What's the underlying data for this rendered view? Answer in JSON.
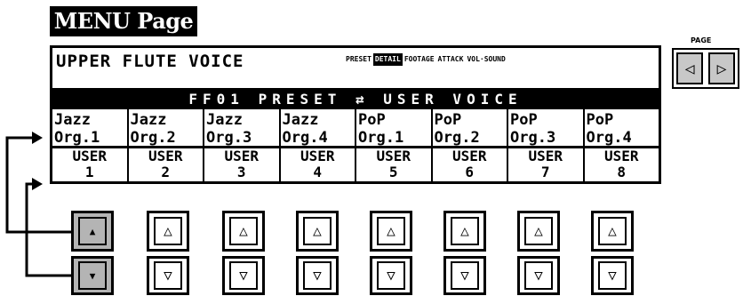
{
  "header": {
    "title": "MENU Page"
  },
  "lcd": {
    "title": "UPPER FLUTE VOICE",
    "tabs": [
      "PRESET",
      "DETAIL",
      "FOOTAGE",
      "ATTACK",
      "VOL·SOUND"
    ],
    "active_tab_index": 1,
    "banner": "FF01 PRESET ⇄ USER VOICE",
    "voices": [
      [
        "Jazz",
        "Org.1"
      ],
      [
        "Jazz",
        "Org.2"
      ],
      [
        "Jazz",
        "Org.3"
      ],
      [
        "Jazz",
        "Org.4"
      ],
      [
        "PoP",
        "Org.1"
      ],
      [
        "PoP",
        "Org.2"
      ],
      [
        "PoP",
        "Org.3"
      ],
      [
        "PoP",
        "Org.4"
      ]
    ],
    "users": [
      [
        "USER",
        "1"
      ],
      [
        "USER",
        "2"
      ],
      [
        "USER",
        "3"
      ],
      [
        "USER",
        "4"
      ],
      [
        "USER",
        "5"
      ],
      [
        "USER",
        "6"
      ],
      [
        "USER",
        "7"
      ],
      [
        "USER",
        "8"
      ]
    ]
  },
  "page": {
    "label": "PAGE"
  },
  "icons": {
    "page_prev": "page-left-arrow-icon",
    "page_next": "page-right-arrow-icon",
    "up": "triangle-up-icon",
    "down": "triangle-down-icon",
    "pointer": "pointer-arrow-icon"
  }
}
